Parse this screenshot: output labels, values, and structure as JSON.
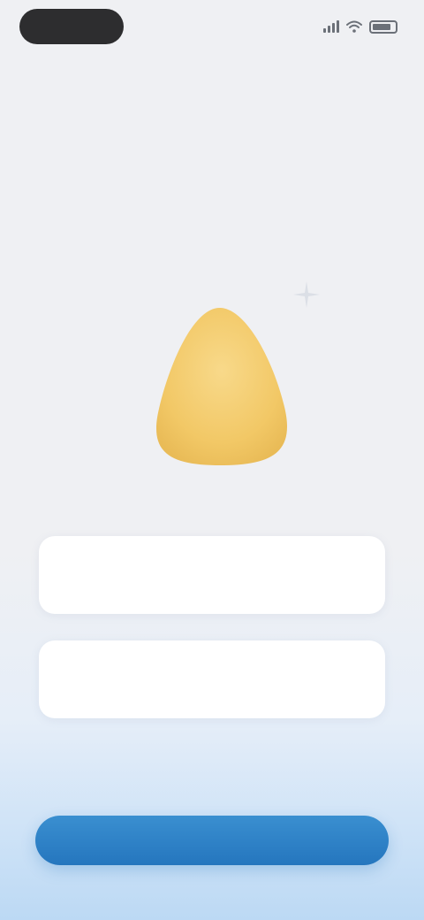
{
  "status_bar": {
    "time": ""
  },
  "headline": {
    "line1": "",
    "accent": "",
    "line2": "",
    "line3": ""
  },
  "cards": [
    {
      "label": "",
      "value": ""
    },
    {
      "label": "",
      "value": ""
    }
  ],
  "primary_button": {
    "label": ""
  },
  "colors": {
    "accent": "#5aa4d8",
    "button": "#2576be",
    "mascot": "#f5cf72",
    "headline": "#33363c"
  },
  "icons": {
    "sparkle": "sparkle-icon",
    "signal": "signal-icon",
    "wifi": "wifi-icon",
    "battery": "battery-icon"
  }
}
